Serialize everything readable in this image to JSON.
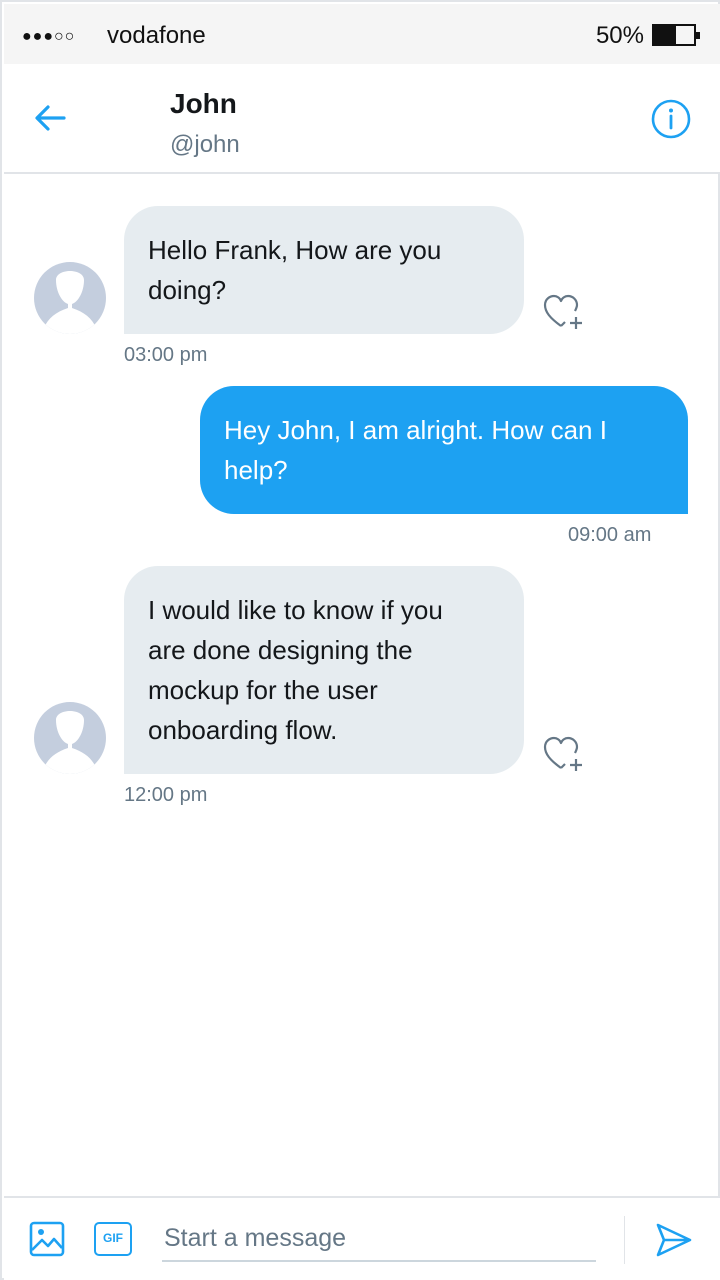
{
  "status_bar": {
    "signal": "●●●○○",
    "carrier": "vodafone",
    "battery": "50%"
  },
  "header": {
    "name": "John",
    "handle": "@john",
    "back_icon": "arrow-left-icon",
    "info_icon": "info-icon"
  },
  "messages": [
    {
      "direction": "incoming",
      "line1": "Hello Frank, How are you",
      "line2": "doing?",
      "time": "03:00 pm"
    },
    {
      "direction": "outgoing",
      "line1": "Hey John, I am alright. How can I",
      "line2": "help?",
      "time": "09:00 am"
    },
    {
      "direction": "incoming",
      "line1": "I would like to know if you",
      "line2": "are done designing the",
      "line3": "mockup for the user",
      "line4": "onboarding flow.",
      "time": "12:00 pm"
    }
  ],
  "composer": {
    "placeholder": "Start a message",
    "gif_label": "GIF",
    "image_icon": "image-icon",
    "send_icon": "send-icon"
  },
  "colors": {
    "accent": "#1da1f2",
    "incoming_bubble": "#e6ecf0",
    "muted_text": "#657786"
  }
}
